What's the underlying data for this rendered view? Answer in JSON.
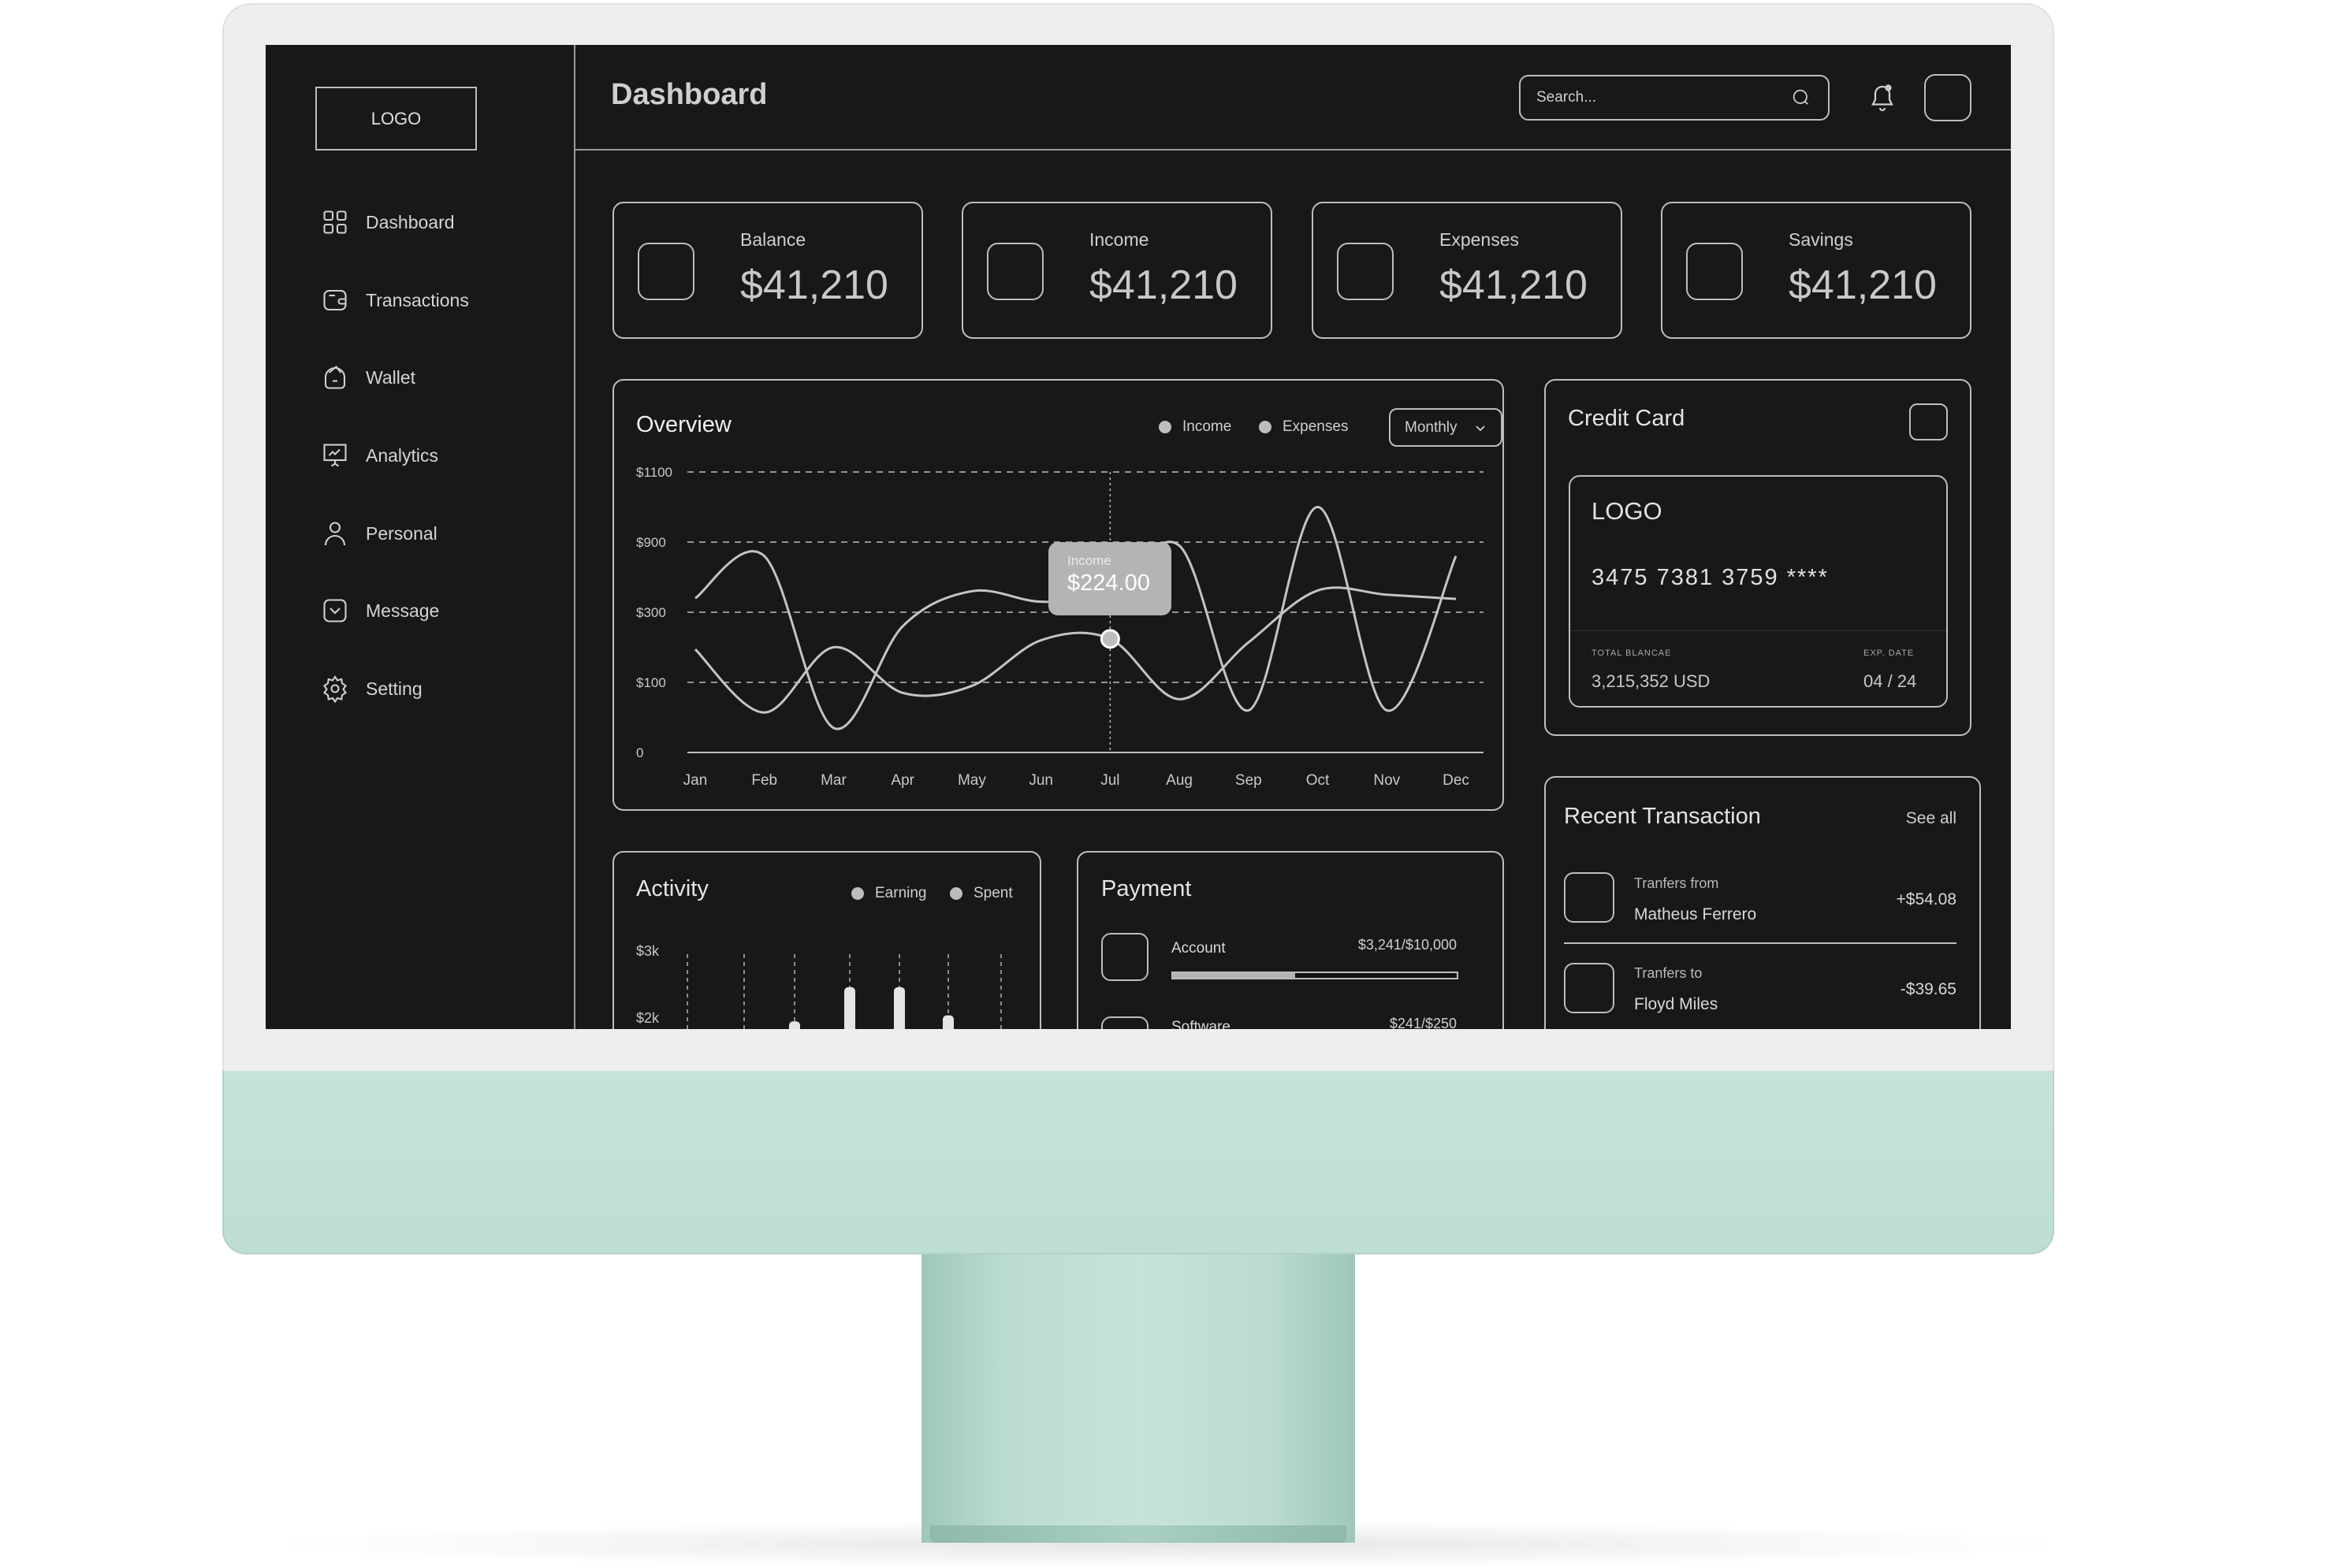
{
  "sidebar": {
    "logo": "LOGO",
    "items": [
      {
        "label": "Dashboard",
        "icon": "grid-icon"
      },
      {
        "label": "Transactions",
        "icon": "card-icon"
      },
      {
        "label": "Wallet",
        "icon": "wallet-icon"
      },
      {
        "label": "Analytics",
        "icon": "presentation-chart-icon"
      },
      {
        "label": "Personal",
        "icon": "user-icon"
      },
      {
        "label": "Message",
        "icon": "message-icon"
      },
      {
        "label": "Setting",
        "icon": "gear-icon"
      }
    ]
  },
  "header": {
    "title": "Dashboard",
    "search_placeholder": "Search..."
  },
  "stats": [
    {
      "label": "Balance",
      "value": "$41,210"
    },
    {
      "label": "Income",
      "value": "$41,210"
    },
    {
      "label": "Expenses",
      "value": "$41,210"
    },
    {
      "label": "Savings",
      "value": "$41,210"
    }
  ],
  "overview": {
    "title": "Overview",
    "legend": [
      "Income",
      "Expenses"
    ],
    "period": "Monthly",
    "tooltip": {
      "label": "Income",
      "value": "$224.00",
      "month": "Jul"
    }
  },
  "chart_data": [
    {
      "type": "line",
      "title": "Overview",
      "y_ticks": [
        "0",
        "$100",
        "$300",
        "$900",
        "$1100"
      ],
      "y_tick_values": [
        0,
        100,
        300,
        900,
        1100
      ],
      "categories": [
        "Jan",
        "Feb",
        "Mar",
        "Apr",
        "May",
        "Jun",
        "Jul",
        "Aug",
        "Sep",
        "Oct",
        "Nov",
        "Dec"
      ],
      "grid": true,
      "legend": "top-right",
      "series": [
        {
          "name": "Income",
          "values": [
            194,
            57,
            200,
            85,
            95,
            220,
            224,
            76,
            214,
            486,
            450,
            414
          ]
        },
        {
          "name": "Expenses",
          "values": [
            420,
            780,
            35,
            260,
            480,
            390,
            450,
            870,
            60,
            1000,
            60,
            780
          ]
        }
      ]
    },
    {
      "type": "bar",
      "title": "Activity",
      "y_ticks": [
        "$3k",
        "$2k"
      ],
      "legend": [
        "Earning",
        "Spent"
      ],
      "values": [
        null,
        null,
        1.95,
        2.46,
        2.46,
        2.04,
        null
      ]
    }
  ],
  "credit_card": {
    "title": "Credit Card",
    "logo": "LOGO",
    "number": "3475 7381 3759 ****",
    "balance_label": "TOTAL BLANCAE",
    "balance": "3,215,352 USD",
    "exp_label": "EXP. DATE",
    "exp": "04 / 24"
  },
  "recent": {
    "title": "Recent Transaction",
    "see_all": "See all",
    "items": [
      {
        "sub": "Tranfers from",
        "name": "Matheus Ferrero",
        "amount": "+$54.08"
      },
      {
        "sub": "Tranfers to",
        "name": "Floyd Miles",
        "amount": "-$39.65"
      }
    ]
  },
  "payment": {
    "title": "Payment",
    "items": [
      {
        "label": "Account",
        "value": "$3,241/$10,000",
        "progress": 0.43
      },
      {
        "label": "Software",
        "value": "$241/$250"
      }
    ]
  },
  "colors": {
    "screen_bg": "#181818",
    "stroke": "#bdbdbd",
    "bezel": "#eeeeee",
    "chin": "#c3e0d6"
  }
}
